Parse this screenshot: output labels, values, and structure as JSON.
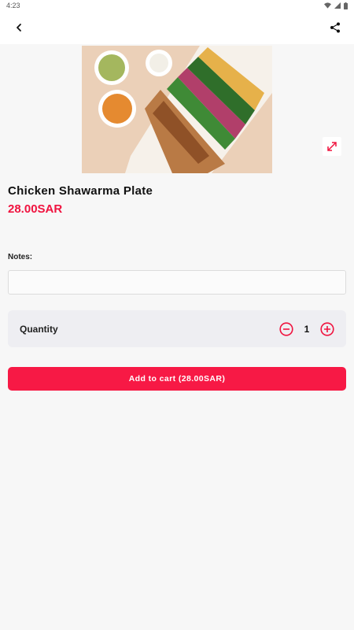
{
  "status_bar": {
    "time": "4:23",
    "icons": [
      "wifi-icon",
      "cell-signal-icon",
      "battery-icon"
    ]
  },
  "app_bar": {
    "back_icon": "chevron-left-icon",
    "share_icon": "share-icon"
  },
  "product": {
    "image_alt": "Chicken Shawarma Plate",
    "name": "Chicken Shawarma Plate",
    "price": "28.00SAR"
  },
  "notes": {
    "label": "Notes:",
    "value": "",
    "placeholder": ""
  },
  "quantity": {
    "label": "Quantity",
    "value": "1"
  },
  "cart": {
    "button_label": "Add to cart (28.00SAR)"
  },
  "colors": {
    "accent": "#f71945",
    "price": "#f0133f",
    "card": "#eeeef2",
    "background": "#f7f7f7"
  }
}
